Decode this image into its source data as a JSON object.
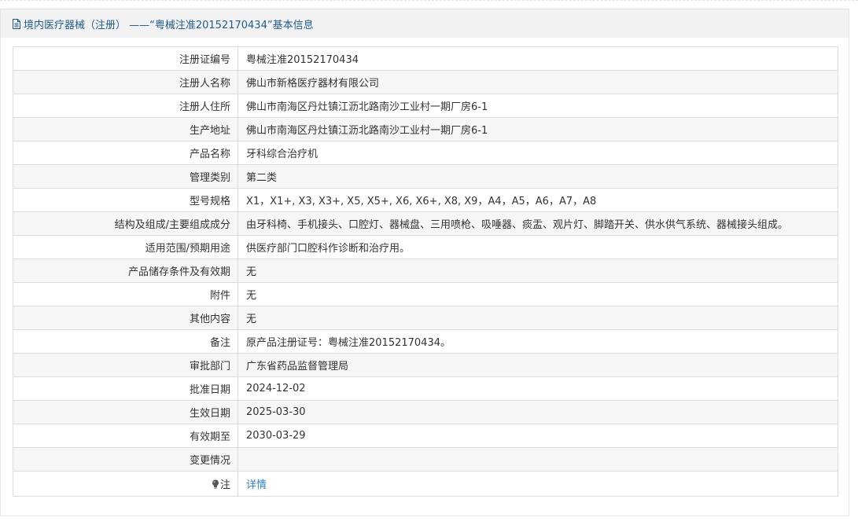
{
  "header": {
    "title": "境内医疗器械（注册） ——“粤械注准20152170434”基本信息",
    "icon": "document-icon"
  },
  "rows": [
    {
      "label": "注册证编号",
      "value": "粤械注准20152170434"
    },
    {
      "label": "注册人名称",
      "value": "佛山市新格医疗器材有限公司"
    },
    {
      "label": "注册人住所",
      "value": "佛山市南海区丹灶镇江沥北路南沙工业村一期厂房6-1"
    },
    {
      "label": "生产地址",
      "value": "佛山市南海区丹灶镇江沥北路南沙工业村一期厂房6-1"
    },
    {
      "label": "产品名称",
      "value": "牙科综合治疗机"
    },
    {
      "label": "管理类别",
      "value": "第二类"
    },
    {
      "label": "型号规格",
      "value": "X1，X1+, X3, X3+, X5, X5+, X6, X6+, X8, X9，A4，A5，A6，A7，A8"
    },
    {
      "label": "结构及组成/主要组成成分",
      "value": "由牙科椅、手机接头、口腔灯、器械盘、三用喷枪、吸唾器、痰盂、观片灯、脚踏开关、供水供气系统、器械接头组成。"
    },
    {
      "label": "适用范围/预期用途",
      "value": "供医疗部门口腔科作诊断和治疗用。"
    },
    {
      "label": "产品储存条件及有效期",
      "value": "无"
    },
    {
      "label": "附件",
      "value": "无"
    },
    {
      "label": "其他内容",
      "value": "无"
    },
    {
      "label": "备注",
      "value": "原产品注册证号：粤械注准20152170434。"
    },
    {
      "label": "审批部门",
      "value": "广东省药品监督管理局"
    },
    {
      "label": "批准日期",
      "value": "2024-12-02"
    },
    {
      "label": "生效日期",
      "value": "2025-03-30"
    },
    {
      "label": "有效期至",
      "value": "2030-03-29"
    },
    {
      "label": "变更情况",
      "value": ""
    }
  ],
  "note": {
    "label": "注",
    "icon": "lightbulb-icon",
    "link_text": "详情"
  },
  "colors": {
    "header_text": "#1f5b8c",
    "header_bg": "#f2f2f2",
    "row_alt_bg": "#f6f6f6",
    "border": "#dcdcdc",
    "link": "#2a7fc4"
  }
}
